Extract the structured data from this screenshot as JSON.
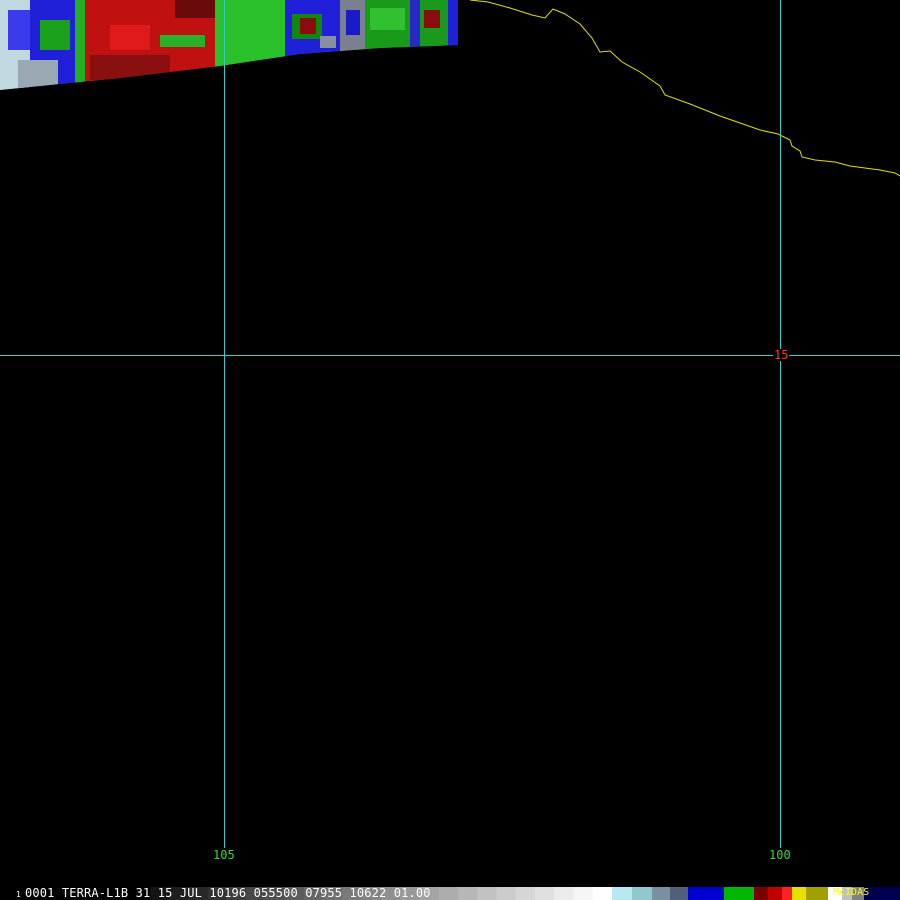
{
  "map": {
    "longitude_labels": [
      "105",
      "100"
    ],
    "latitude_labels": [
      "15"
    ],
    "colors": {
      "background": "#000000",
      "grid": "#33cccc",
      "coastline": "#e0e000",
      "longitude_label": "#33dd33",
      "latitude_label": "#ff3333"
    }
  },
  "status_bar": {
    "frame_number": "1",
    "info": "0001 TERRA-L1B 31 15 JUL 10196 055500 07955 10622 01.00",
    "brand": "McIDAS"
  }
}
